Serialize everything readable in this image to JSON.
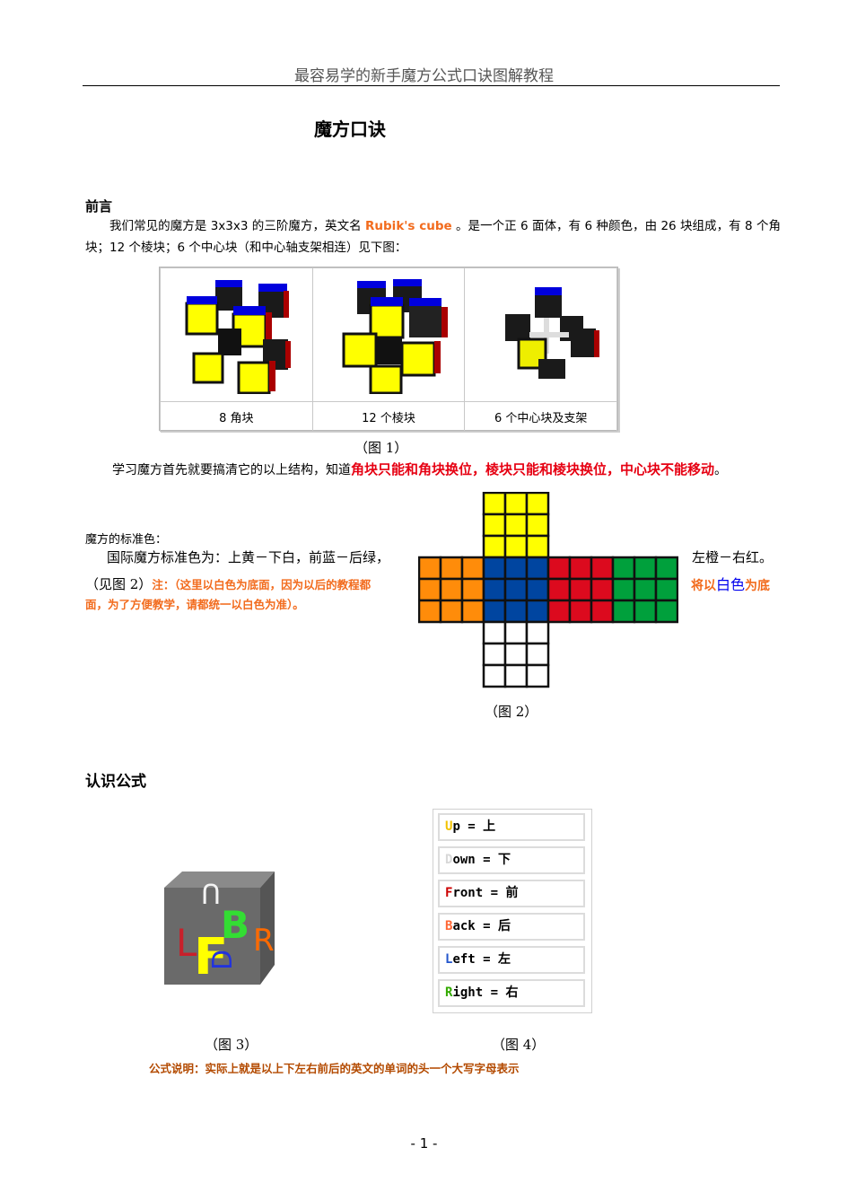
{
  "header": {
    "title": "最容易学的新手魔方公式口诀图解教程"
  },
  "doc_title": "魔方口诀",
  "preface": {
    "heading": "前言",
    "p1_a": "我们常见的魔方是 3x3x3 的三阶魔方，英文名 ",
    "p1_english": "Rubik's cube",
    "p1_b": " 。是一个正 6 面体，有 6 种颜色，由 26 块组成，有 8 个角块；12 个棱块；6 个中心块（和中心轴支架相连）见下图："
  },
  "figure1": {
    "labels": [
      "8 角块",
      "12 个棱块",
      "6 个中心块及支架"
    ],
    "caption": "（图 1）"
  },
  "structure_note": {
    "lead": "学习魔方首先就要搞清它的以上结构，知道",
    "highlight": "角块只能和角块换位，棱块只能和棱块换位，中心块不能移动",
    "end": "。"
  },
  "standard_colors": {
    "heading": "魔方的标准色：",
    "line1": "国际魔方标准色为：上黄－下白，前蓝－后绿，",
    "line1_right": "左橙－右红。",
    "line2_lead": "（见图 2）",
    "line2_note": "注：（这里以白色为底面，因为以后的教程都",
    "line2_right_a": "将以",
    "line2_right_white": "白",
    "line2_right_color": "色",
    "line2_right_b": "为底",
    "line3": "面，为了方便教学，请都统一以白色为准）。",
    "colors": {
      "yellow": "#ffff00",
      "orange": "#ff8c0a",
      "blue": "#0045a0",
      "red": "#dc0a1e",
      "green": "#00a03c",
      "white": "#ffffff"
    }
  },
  "figure2": {
    "caption": "（图 2）"
  },
  "formula": {
    "heading": "认识公式",
    "moves": [
      {
        "letter": "U",
        "rest": "p = 上",
        "color": "#f2c200"
      },
      {
        "letter": "D",
        "rest": "own = 下",
        "color": "#d8d8d8"
      },
      {
        "letter": "F",
        "rest": "ront = 前",
        "color": "#cc0000"
      },
      {
        "letter": "B",
        "rest": "ack = 后",
        "color": "#ff6633"
      },
      {
        "letter": "L",
        "rest": "eft = 左",
        "color": "#2255cc"
      },
      {
        "letter": "R",
        "rest": "ight = 右",
        "color": "#33aa00"
      }
    ],
    "cube_letters": [
      "U",
      "L",
      "F",
      "B",
      "R",
      "D"
    ],
    "caption3": "（图 3）",
    "caption4": "（图 4）",
    "note": "公式说明：实际上就是以上下左右前后的英文的单词的头一个大写字母表示"
  },
  "footer": {
    "page": "- 1 -"
  }
}
